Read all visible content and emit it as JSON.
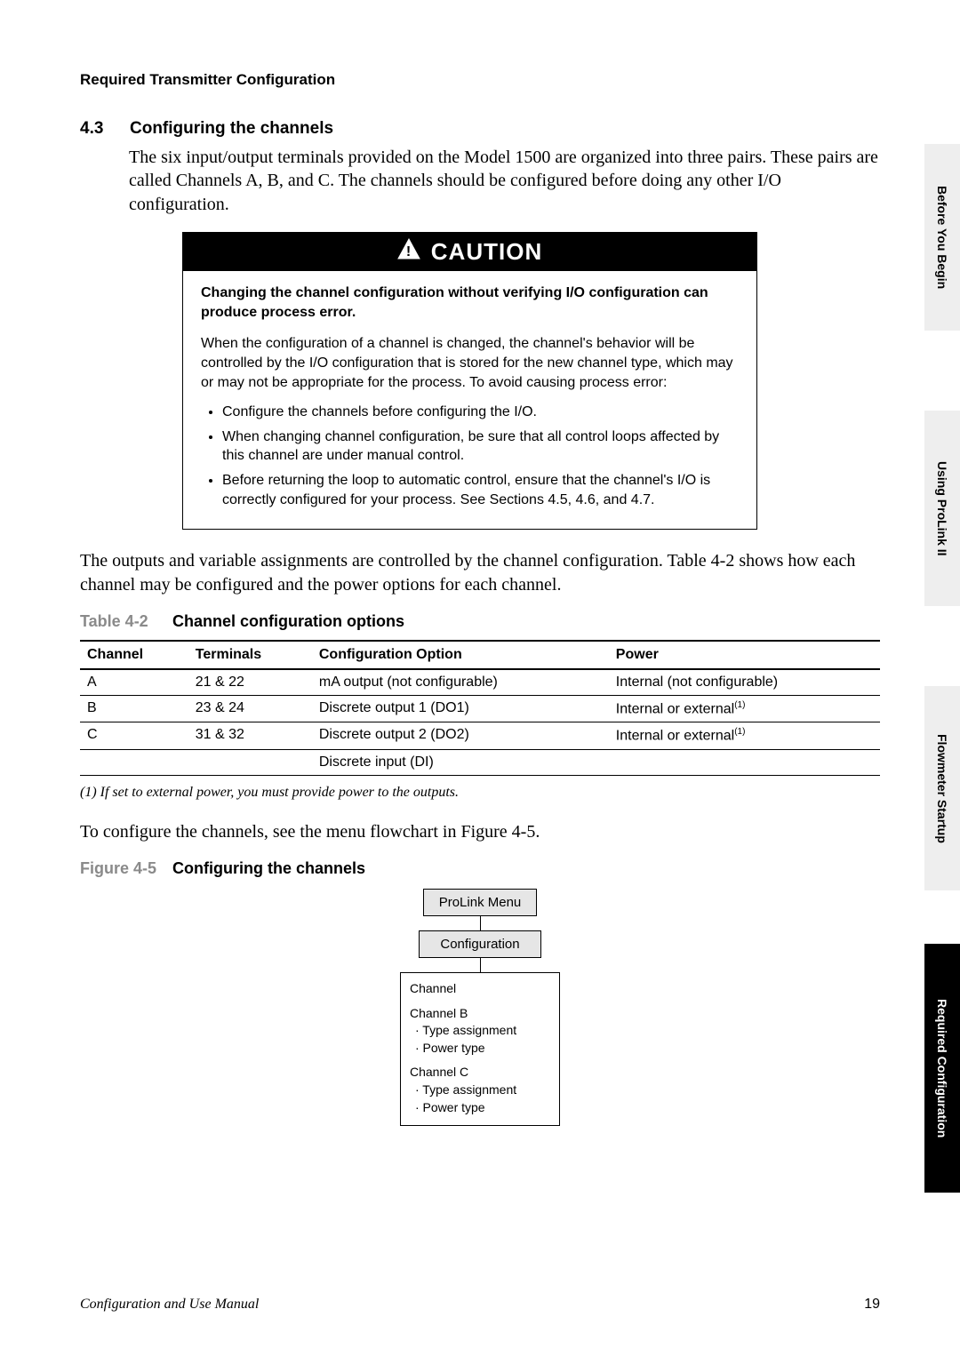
{
  "running_head": "Required Transmitter Configuration",
  "section": {
    "number": "4.3",
    "title": "Configuring the channels",
    "para1": "The six input/output terminals provided on the Model 1500 are organized into three pairs. These pairs are called Channels A, B, and C. The channels should be configured before doing any other I/O configuration."
  },
  "caution": {
    "label": "CAUTION",
    "bold": "Changing the channel configuration without verifying I/O configuration can produce process error.",
    "para": "When the configuration of a channel is changed, the channel's behavior will be controlled by the I/O configuration that is stored for the new channel type, which may or may not be appropriate for the process. To avoid causing process error:",
    "bullets": [
      "Configure the channels before configuring the I/O.",
      "When changing channel configuration, be sure that all control loops affected by this channel are under manual control.",
      "Before returning the loop to automatic control, ensure that the channel's I/O is correctly configured for your process. See Sections 4.5, 4.6, and 4.7."
    ]
  },
  "para_after_caution": "The outputs and variable assignments are controlled by the channel configuration. Table 4-2 shows how each channel may be configured and the power options for each channel.",
  "table": {
    "tag": "Table 4-2",
    "title": "Channel configuration options",
    "headers": [
      "Channel",
      "Terminals",
      "Configuration Option",
      "Power"
    ],
    "rows": [
      {
        "c": "A",
        "t": "21 & 22",
        "o": "mA output (not configurable)",
        "p": "Internal (not configurable)",
        "sup": ""
      },
      {
        "c": "B",
        "t": "23 & 24",
        "o": "Discrete output 1 (DO1)",
        "p": "Internal or external",
        "sup": "(1)"
      },
      {
        "c": "C",
        "t": "31 & 32",
        "o": "Discrete output 2 (DO2)",
        "p": "Internal or external",
        "sup": "(1)"
      },
      {
        "c": "",
        "t": "",
        "o": "Discrete input (DI)",
        "p": "",
        "sup": ""
      }
    ],
    "footnote": "(1) If set to external power, you must provide power to the outputs."
  },
  "para_before_figure": "To configure the channels, see the menu flowchart in Figure 4-5.",
  "figure": {
    "tag": "Figure 4-5",
    "title": "Configuring the channels",
    "box1": "ProLink Menu",
    "box2": "Configuration",
    "detail_head": "Channel",
    "groupB_title": "Channel B",
    "groupB_items": [
      "· Type assignment",
      "· Power type"
    ],
    "groupC_title": "Channel C",
    "groupC_items": [
      "· Type assignment",
      "· Power type"
    ]
  },
  "tabs": [
    "Before You Begin",
    "Using ProLink II",
    "Flowmeter Startup",
    "Required Configuration"
  ],
  "footer": {
    "left": "Configuration and Use Manual",
    "right": "19"
  }
}
